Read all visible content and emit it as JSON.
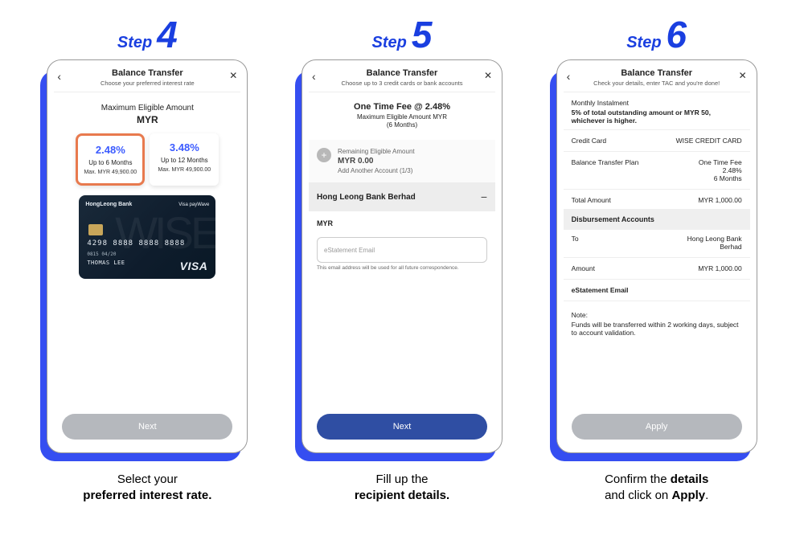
{
  "steps": {
    "word": "Step",
    "nums": [
      "4",
      "5",
      "6"
    ]
  },
  "captions": {
    "s4a": "Select your",
    "s4b": "preferred interest rate.",
    "s5a": "Fill up the",
    "s5b": "recipient details.",
    "s6a": "Confirm the ",
    "s6b": "details",
    "s6c": " and click on ",
    "s6d": "Apply",
    "s6e": "."
  },
  "header": {
    "title": "Balance Transfer",
    "back": "‹",
    "close": "✕",
    "sub4": "Choose your preferred interest rate",
    "sub5": "Choose up to 3 credit cards or bank accounts",
    "sub6": "Check your details, enter TAC and you're done!"
  },
  "step4": {
    "eligible_label": "Maximum Eligible Amount",
    "currency": "MYR",
    "rates": [
      {
        "rate": "2.48%",
        "term": "Up to 6 Months",
        "max": "Max. MYR 49,900.00"
      },
      {
        "rate": "3.48%",
        "term": "Up to 12 Months",
        "max": "Max. MYR 49,900.00"
      }
    ],
    "card": {
      "bank": "HongLeong Bank",
      "paywave": "Visa payWave",
      "wise": "WISE",
      "number": "4298 8888 8888 8888",
      "meta": "0815   04/20",
      "name": "THOMAS LEE",
      "visa": "VISA"
    },
    "next": "Next"
  },
  "step5": {
    "title": "One Time Fee @ 2.48%",
    "sub1": "Maximum Eligible Amount MYR",
    "sub2": "(6 Months)",
    "remaining_label": "Remaining Eligible Amount",
    "remaining_value": "MYR 0.00",
    "add_account": "Add Another Account (1/3)",
    "bank": "Hong Leong Bank Berhad",
    "minus": "−",
    "plus": "+",
    "myr_label": "MYR",
    "email_placeholder": "eStatement Email",
    "email_hint": "This email address will be used for all future correspondence.",
    "next": "Next"
  },
  "step6": {
    "instal_head": "Monthly Instalment",
    "instal_desc": "5% of total outstanding amount or MYR 50, whichever is higher.",
    "cc_k": "Credit Card",
    "cc_v": "WISE CREDIT CARD",
    "plan_k": "Balance Transfer Plan",
    "plan_v1": "One Time Fee",
    "plan_v2": "2.48%",
    "plan_v3": "6 Months",
    "total_k": "Total Amount",
    "total_v": "MYR 1,000.00",
    "disb": "Disbursement Accounts",
    "to_k": "To",
    "to_v1": "Hong Leong Bank",
    "to_v2": "Berhad",
    "amt_k": "Amount",
    "amt_v": "MYR 1,000.00",
    "estmt_k": "eStatement Email",
    "note_t": "Note:",
    "note_d": "Funds will be transferred within 2 working days, subject to account validation.",
    "apply": "Apply"
  }
}
